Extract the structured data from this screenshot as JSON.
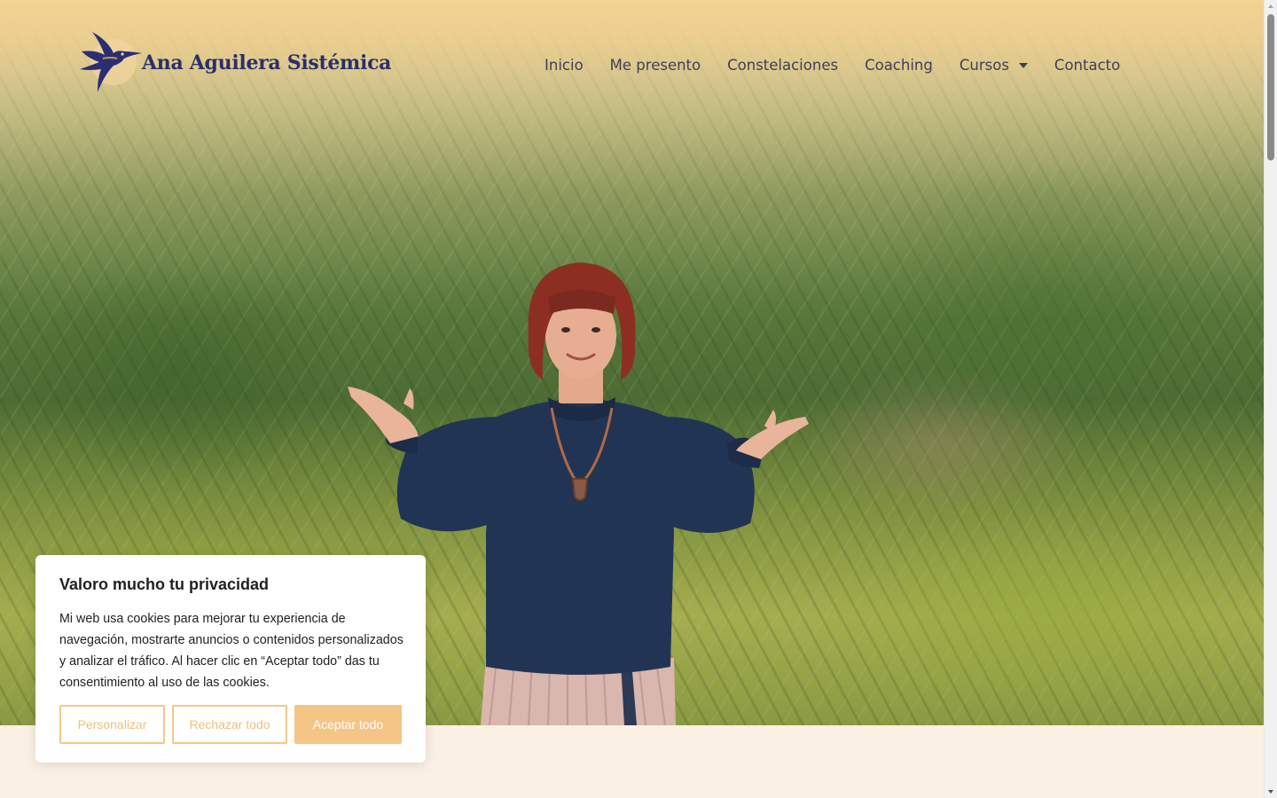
{
  "brand": {
    "name": "Ana Aguilera Sistémica",
    "logo_icon": "hummingbird-icon",
    "text_color": "#2b2f6b"
  },
  "nav": {
    "items": [
      {
        "label": "Inicio"
      },
      {
        "label": "Me presento"
      },
      {
        "label": "Constelaciones"
      },
      {
        "label": "Coaching"
      },
      {
        "label": "Cursos",
        "has_dropdown": true
      },
      {
        "label": "Contacto"
      }
    ]
  },
  "hero": {
    "image": "woman-with-open-hands-in-front-of-oleander-bushes",
    "top_fade_color": "#f4d393"
  },
  "cookie_banner": {
    "title": "Valoro mucho tu privacidad",
    "text": "Mi web usa cookies para mejorar tu experiencia de navegación, mostrarte anuncios o contenidos personalizados y analizar el tráfico. Al hacer clic en “Aceptar todo” das tu consentimiento al uso de las cookies.",
    "customize_label": "Personalizar",
    "reject_label": "Rechazar todo",
    "accept_label": "Aceptar todo",
    "accent_color": "#f4c585"
  },
  "page": {
    "background_color": "#faf1e4"
  }
}
